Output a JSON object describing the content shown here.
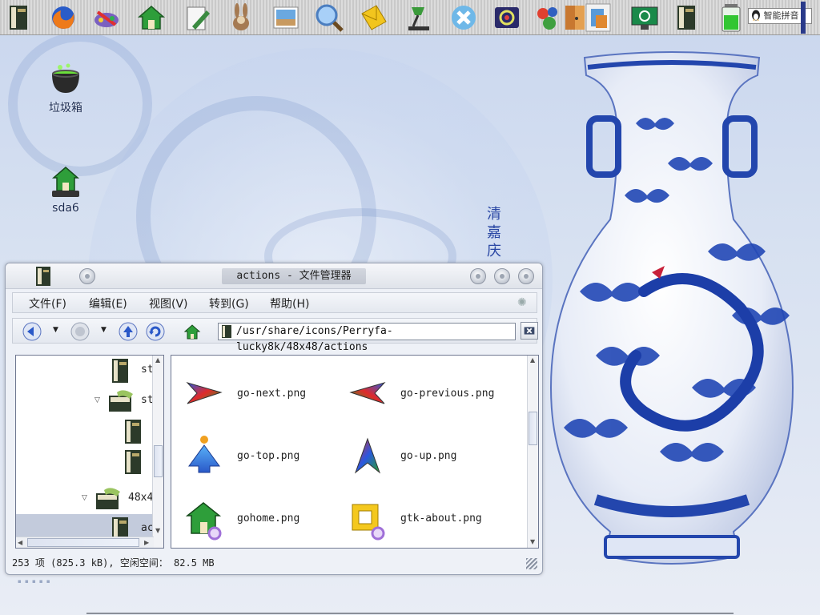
{
  "panel": {
    "launchers": [
      "book-icon",
      "firefox-icon",
      "paint-icon",
      "home-icon",
      "editor-icon",
      "rabbit-icon",
      "image-viewer-icon",
      "search-icon",
      "mail-icon",
      "lamp-icon",
      "close-x-icon",
      "settings-icon",
      "games-icon",
      "door-icon",
      "clipboard-icon",
      "screen-icon",
      "book-icon",
      "battery-icon"
    ],
    "ime_label": "智能拼音"
  },
  "desktop": {
    "trash_label": "垃圾箱",
    "drive_label": "sda6",
    "calligraphy": [
      "清",
      "嘉",
      "庆"
    ]
  },
  "window": {
    "title": "actions - 文件管理器",
    "menus": [
      "文件(F)",
      "编辑(E)",
      "视图(V)",
      "转到(G)",
      "帮助(H)"
    ],
    "location": "/usr/share/icons/Perryfa-lucky8k/48x48/actions",
    "tree_items": [
      {
        "label": "st",
        "expanded": false
      },
      {
        "label": "st",
        "expanded": true
      },
      {
        "label": "",
        "expanded": false
      },
      {
        "label": "",
        "expanded": false
      },
      {
        "label": "48x4",
        "expanded": true
      },
      {
        "label": "ac",
        "expanded": false,
        "selected": true
      }
    ],
    "files": [
      {
        "name": "go-next.png",
        "icon": "arrow-right-icon"
      },
      {
        "name": "go-previous.png",
        "icon": "arrow-left-icon"
      },
      {
        "name": "go-top.png",
        "icon": "arrow-top-icon"
      },
      {
        "name": "go-up.png",
        "icon": "arrow-up-icon"
      },
      {
        "name": "gohome.png",
        "icon": "home-icon"
      },
      {
        "name": "gtk-about.png",
        "icon": "about-icon"
      }
    ],
    "status": "253 项 (825.3 kB), 空闲空间： 82.5 MB"
  },
  "colors": {
    "porcelain_blue": "#1f3fa8",
    "desktop_bg": "#d7e1f1",
    "selection": "#c3cbdc"
  }
}
